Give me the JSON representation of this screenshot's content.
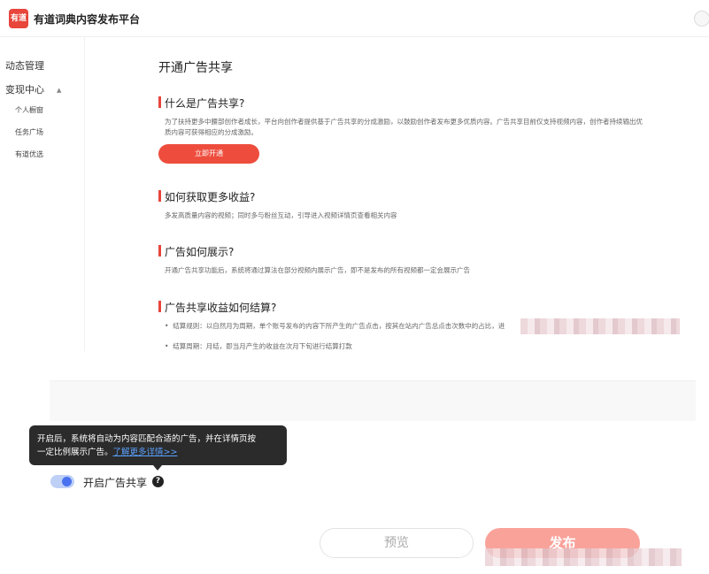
{
  "header": {
    "logo_text": "有道",
    "app_name": "有道词典内容发布平台"
  },
  "sidebar": {
    "items": [
      {
        "label": "动态管理"
      },
      {
        "label": "变现中心",
        "expanded": true,
        "children": [
          {
            "label": "个人橱窗"
          },
          {
            "label": "任务广场"
          },
          {
            "label": "有道优选"
          }
        ]
      }
    ]
  },
  "main": {
    "title": "开通广告共享",
    "sections": [
      {
        "title": "什么是广告共享?",
        "text_line1": "为了扶持更多中腰部创作者成长，平台向创作者提供基于广告共享的分成激励，以鼓励创作者发布更多优质内容。广告共享目前仅支持视频内容，创作者持续输出优",
        "text_line2": "质内容可获得相应的分成激励。",
        "button": "立即开通"
      },
      {
        "title": "如何获取更多收益?",
        "text": "多发高质量内容的视频；同时多与粉丝互动，引导进入视频详情页查看相关内容"
      },
      {
        "title": "广告如何展示?",
        "text": "开通广告共享功能后，系统将通过算法在部分视频内展示广告，即不是发布的所有视频都一定会展示广告"
      },
      {
        "title": "广告共享收益如何结算?",
        "bullets": [
          "结算规则：以自然月为周期，单个账号发布的内容下所产生的广告点击，按其在站内广告总点击次数中的占比，进",
          "结算周期：月结，即当月产生的收益在次月下旬进行结算打款"
        ]
      }
    ]
  },
  "tooltip": {
    "line1": "开启后，系统将自动为内容匹配合适的广告，并在详情页按",
    "line2": "一定比例展示广告。",
    "link": "了解更多详情>>"
  },
  "toggle": {
    "label": "开启广告共享",
    "on": true,
    "help_glyph": "?"
  },
  "actions": {
    "preview": "预览",
    "publish": "发布"
  },
  "colors": {
    "accent": "#ee4d3d",
    "toggle_on": "#4a72f0",
    "tooltip_bg": "#2b2b2b",
    "publish_disabled": "#f9a29a"
  }
}
